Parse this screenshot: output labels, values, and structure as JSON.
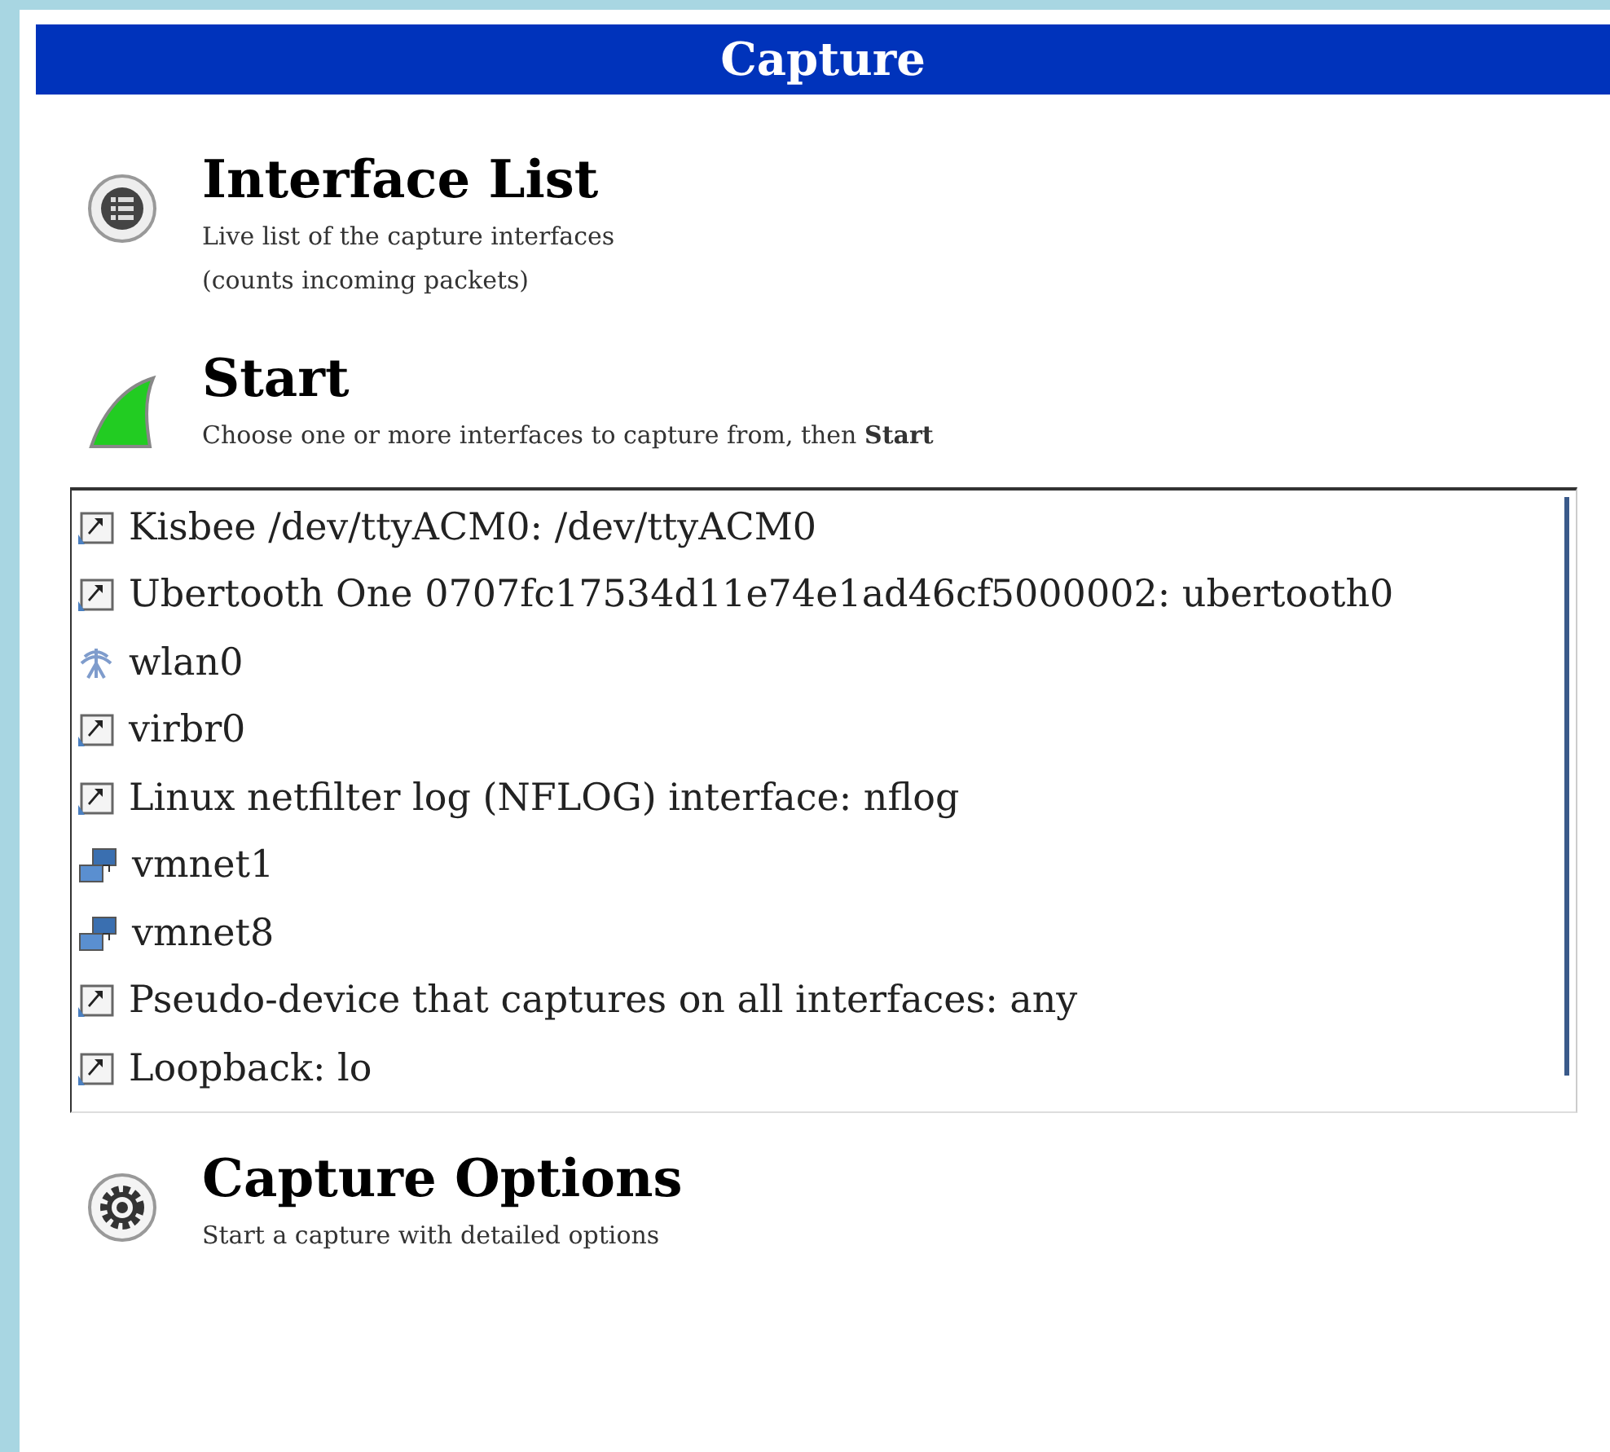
{
  "header": {
    "title": "Capture"
  },
  "sections_top": [
    {
      "kind": "list",
      "title": "Interface List",
      "lines": [
        "Live list of the capture interfaces",
        "(counts incoming packets)"
      ]
    },
    {
      "kind": "start",
      "title": "Start",
      "lines": [
        "Choose one or more interfaces to capture from, then **Start**"
      ]
    }
  ],
  "interfaces": [
    {
      "kind": "port",
      "label": "Kisbee /dev/ttyACM0: /dev/ttyACM0"
    },
    {
      "kind": "port",
      "label": "Ubertooth One 0707fc17534d11e74e1ad46cf5000002: ubertooth0"
    },
    {
      "kind": "wireless",
      "label": "wlan0"
    },
    {
      "kind": "port",
      "label": "virbr0"
    },
    {
      "kind": "port",
      "label": "Linux netfilter log (NFLOG) interface: nflog"
    },
    {
      "kind": "network",
      "label": "vmnet1"
    },
    {
      "kind": "network",
      "label": "vmnet8"
    },
    {
      "kind": "port",
      "label": "Pseudo-device that captures on all interfaces: any"
    },
    {
      "kind": "port",
      "label": "Loopback: lo"
    }
  ],
  "sections_bottom": [
    {
      "kind": "options",
      "title": "Capture Options",
      "lines": [
        "Start a capture with detailed options"
      ]
    }
  ]
}
